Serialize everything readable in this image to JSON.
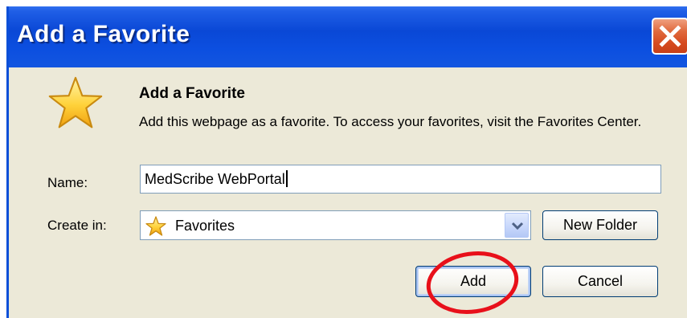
{
  "window": {
    "title": "Add a Favorite"
  },
  "header": {
    "heading": "Add a Favorite",
    "description": "Add this webpage as a favorite. To access your favorites, visit the Favorites Center."
  },
  "form": {
    "name_label": "Name:",
    "name_value": "MedScribe WebPortal",
    "create_in_label": "Create in:",
    "create_in_value": "Favorites"
  },
  "buttons": {
    "new_folder": "New Folder",
    "add": "Add",
    "cancel": "Cancel"
  },
  "icons": {
    "favorite": "star-icon",
    "folder": "star-icon",
    "dropdown": "chevron-down-icon",
    "close": "close-icon"
  },
  "colors": {
    "titlebar": "#0a48d6",
    "close_button": "#d64b20",
    "dialog_background": "#ece9d8",
    "annotation": "#e8101a"
  }
}
